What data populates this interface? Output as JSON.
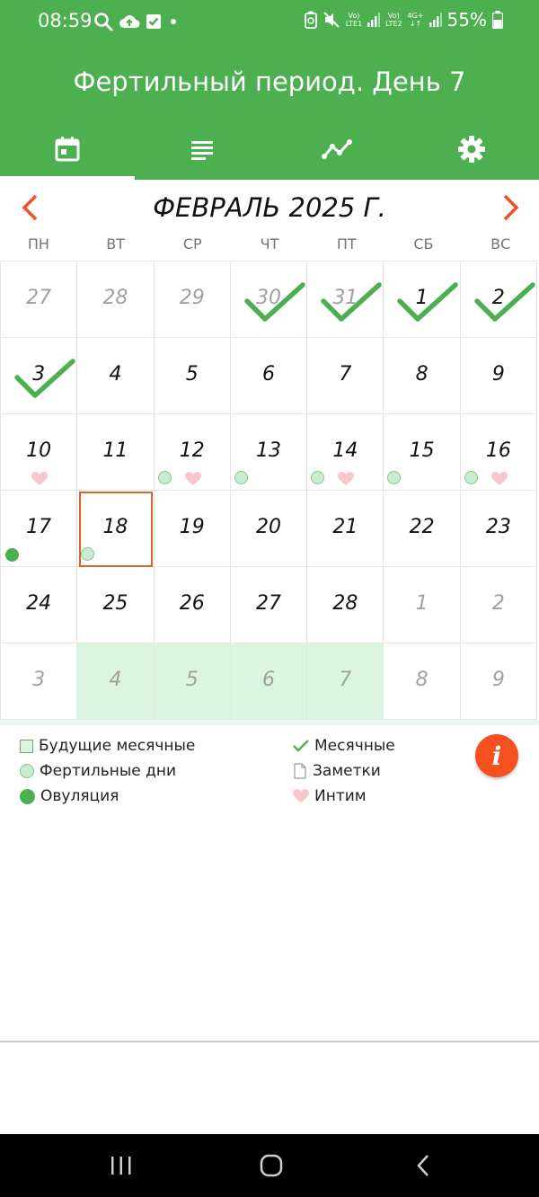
{
  "status_bar": {
    "time": "08:59",
    "battery": "55%",
    "net1": [
      "Vo)",
      "LTE1"
    ],
    "net2": [
      "Vo)",
      "LTE2"
    ],
    "net3": [
      "4G+",
      ""
    ]
  },
  "app_bar": {
    "title": "Фертильный период. День 7"
  },
  "tabs": [
    {
      "icon": "calendar-icon"
    },
    {
      "icon": "list-icon"
    },
    {
      "icon": "chart-icon"
    },
    {
      "icon": "gear-icon"
    }
  ],
  "calendar": {
    "month_title": "ФЕВРАЛЬ 2025 Г.",
    "weekdays": [
      "ПН",
      "ВТ",
      "СР",
      "ЧТ",
      "ПТ",
      "СБ",
      "ВС"
    ],
    "weeks": [
      [
        {
          "d": "27",
          "m": 1
        },
        {
          "d": "28",
          "m": 1
        },
        {
          "d": "29",
          "m": 1
        },
        {
          "d": "30",
          "m": 1,
          "c": 1
        },
        {
          "d": "31",
          "m": 1,
          "c": 1
        },
        {
          "d": "1",
          "c": 1
        },
        {
          "d": "2",
          "c": 1
        }
      ],
      [
        {
          "d": "3",
          "c": 1
        },
        {
          "d": "4"
        },
        {
          "d": "5"
        },
        {
          "d": "6"
        },
        {
          "d": "7"
        },
        {
          "d": "8"
        },
        {
          "d": "9"
        }
      ],
      [
        {
          "d": "10",
          "h": 1
        },
        {
          "d": "11"
        },
        {
          "d": "12",
          "f": 1,
          "h": 1
        },
        {
          "d": "13",
          "f": 1
        },
        {
          "d": "14",
          "f": 1,
          "h": 1
        },
        {
          "d": "15",
          "f": 1
        },
        {
          "d": "16",
          "f": 1,
          "h": 1
        }
      ],
      [
        {
          "d": "17",
          "o": 1
        },
        {
          "d": "18",
          "f": 1,
          "t": 1
        },
        {
          "d": "19"
        },
        {
          "d": "20"
        },
        {
          "d": "21"
        },
        {
          "d": "22"
        },
        {
          "d": "23"
        }
      ],
      [
        {
          "d": "24"
        },
        {
          "d": "25"
        },
        {
          "d": "26"
        },
        {
          "d": "27"
        },
        {
          "d": "28"
        },
        {
          "d": "1",
          "m": 1
        },
        {
          "d": "2",
          "m": 1
        }
      ],
      [
        {
          "d": "3",
          "m": 1
        },
        {
          "d": "4",
          "m": 1,
          "p": 1
        },
        {
          "d": "5",
          "m": 1,
          "p": 1
        },
        {
          "d": "6",
          "m": 1,
          "p": 1
        },
        {
          "d": "7",
          "m": 1,
          "p": 1
        },
        {
          "d": "8",
          "m": 1
        },
        {
          "d": "9",
          "m": 1
        }
      ]
    ]
  },
  "legend": {
    "future_periods": "Будущие месячные",
    "fertile_days": "Фертильные дни",
    "ovulation": "Овуляция",
    "periods": "Месячные",
    "notes": "Заметки",
    "intimacy": "Интим"
  },
  "info_button": {
    "label": "i"
  },
  "colors": {
    "primary": "#4caf50",
    "accent": "#f4511e",
    "future_bg": "#dcf5e1",
    "fertile": "#c8eccd",
    "heart": "#f8c6cf",
    "today_border": "#e0622e"
  }
}
